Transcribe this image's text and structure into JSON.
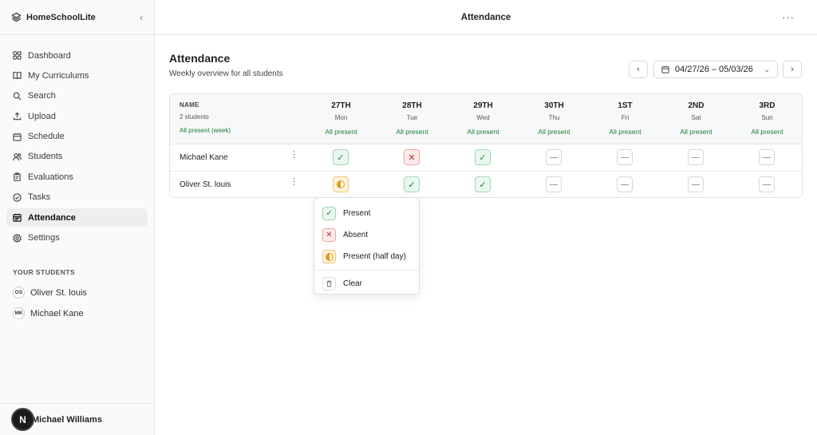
{
  "app": {
    "name": "HomeSchoolLite"
  },
  "sidebar": {
    "items": [
      {
        "label": "Dashboard",
        "icon": "grid-icon"
      },
      {
        "label": "My Curriculums",
        "icon": "book-icon"
      },
      {
        "label": "Search",
        "icon": "search-icon"
      },
      {
        "label": "Upload",
        "icon": "upload-icon"
      },
      {
        "label": "Schedule",
        "icon": "calendar-icon"
      },
      {
        "label": "Students",
        "icon": "users-icon"
      },
      {
        "label": "Evaluations",
        "icon": "clipboard-icon"
      },
      {
        "label": "Tasks",
        "icon": "check-circle-icon"
      },
      {
        "label": "Attendance",
        "icon": "calendar-check-icon",
        "active": true
      },
      {
        "label": "Settings",
        "icon": "gear-icon"
      }
    ],
    "students_title": "YOUR STUDENTS",
    "students": [
      {
        "initials": "OS",
        "name": "Oliver St. louis"
      },
      {
        "initials": "MK",
        "name": "Michael Kane"
      }
    ],
    "user": {
      "avatar": "N",
      "name": "Michael Williams"
    }
  },
  "topbar": {
    "title": "Attendance",
    "more": "···"
  },
  "page": {
    "title": "Attendance",
    "subtitle": "Weekly overview for all students",
    "date_range": "04/27/26 – 05/03/26"
  },
  "table": {
    "name_header": "NAME",
    "student_count": "2 students",
    "all_present_week": "All present (week)",
    "days": [
      {
        "num": "27TH",
        "weekday": "Mon",
        "status": "All present"
      },
      {
        "num": "28TH",
        "weekday": "Tue",
        "status": "All present"
      },
      {
        "num": "29TH",
        "weekday": "Wed",
        "status": "All present"
      },
      {
        "num": "30TH",
        "weekday": "Thu",
        "status": "All present"
      },
      {
        "num": "1ST",
        "weekday": "Fri",
        "status": "All present"
      },
      {
        "num": "2ND",
        "weekday": "Sat",
        "status": "All present"
      },
      {
        "num": "3RD",
        "weekday": "Sun",
        "status": "All present"
      }
    ],
    "rows": [
      {
        "name": "Michael Kane",
        "cells": [
          "present",
          "absent",
          "present",
          "empty",
          "empty",
          "empty",
          "empty"
        ]
      },
      {
        "name": "Oliver St. louis",
        "cells": [
          "half",
          "present",
          "present",
          "empty",
          "empty",
          "empty",
          "empty"
        ]
      }
    ]
  },
  "menu": {
    "items": [
      {
        "label": "Present",
        "kind": "present"
      },
      {
        "label": "Absent",
        "kind": "absent"
      },
      {
        "label": "Present (half day)",
        "kind": "half"
      },
      {
        "label": "Clear",
        "kind": "clear"
      }
    ]
  },
  "colors": {
    "present_green": "#1a7f37",
    "absent_red": "#c62828",
    "half_orange": "#e39a1e",
    "active_nav_bg": "#eceef0"
  }
}
